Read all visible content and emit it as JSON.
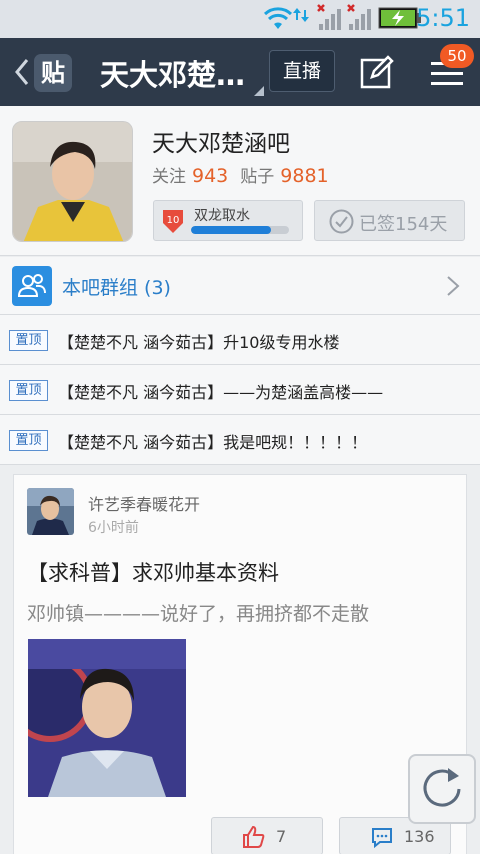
{
  "status_bar": {
    "time": "5:51"
  },
  "app_bar": {
    "logo_text": "贴",
    "title": "天大邓楚…",
    "live_button": "直播",
    "notification_badge": "50"
  },
  "forum": {
    "name": "天大邓楚涵吧",
    "follow_label": "关注",
    "follow_count": "943",
    "posts_label": "贴子",
    "posts_count": "9881",
    "level_number": "10",
    "level_title": "双龙取水",
    "level_progress": 0.82,
    "signed_label": "已签154天"
  },
  "groups": {
    "label": "本吧群组 (3)"
  },
  "pinned_posts": [
    {
      "tag": "置顶",
      "title": "【楚楚不凡 涵今茹古】升10级专用水楼"
    },
    {
      "tag": "置顶",
      "title": "【楚楚不凡 涵今茹古】——为楚涵盖高楼——"
    },
    {
      "tag": "置顶",
      "title": "【楚楚不凡 涵今茹古】我是吧规！！！！！"
    }
  ],
  "post": {
    "author": "许艺季春暖花开",
    "time": "6小时前",
    "title": "【求科普】求邓帅基本资料",
    "body": "邓帅镇————说好了，再拥挤都不走散",
    "likes": "7",
    "comments": "136"
  },
  "colors": {
    "accent_orange": "#e4622a",
    "app_bar": "#2e3a4a",
    "link_blue": "#2a7ec9",
    "badge": "#f15a24"
  }
}
